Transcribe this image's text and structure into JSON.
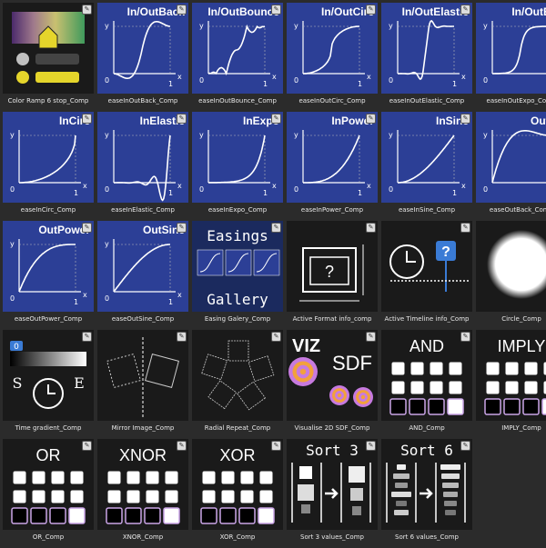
{
  "tiles": [
    {
      "caption": "Color Ramp 6 stop_Comp",
      "kind": "ramp"
    },
    {
      "caption": "easeInOutBack_Comp",
      "kind": "ease",
      "title": "In/OutBack",
      "curve": "inoutback"
    },
    {
      "caption": "easeInOutBounce_Comp",
      "kind": "ease",
      "title": "In/OutBounce",
      "curve": "inoutbounce"
    },
    {
      "caption": "easeInOutCirc_Comp",
      "kind": "ease",
      "title": "In/OutCirc",
      "curve": "inoutcirc"
    },
    {
      "caption": "easeInOutElastic_Comp",
      "kind": "ease",
      "title": "In/OutElastic",
      "curve": "inoutelastic"
    },
    {
      "caption": "easeInOutExpo_Comp",
      "kind": "ease",
      "title": "In/OutExp",
      "curve": "inoutexpo"
    },
    {
      "caption": "easeInCirc_Comp",
      "kind": "ease",
      "title": "InCirc",
      "curve": "incirc"
    },
    {
      "caption": "easeInElastic_Comp",
      "kind": "ease",
      "title": "InElastic",
      "curve": "inelastic"
    },
    {
      "caption": "easeInExpo_Comp",
      "kind": "ease",
      "title": "InExpo",
      "curve": "inexpo"
    },
    {
      "caption": "easeInPower_Comp",
      "kind": "ease",
      "title": "InPower",
      "curve": "inpower"
    },
    {
      "caption": "easeInSine_Comp",
      "kind": "ease",
      "title": "InSine",
      "curve": "insine"
    },
    {
      "caption": "easeOutBack_Comp",
      "kind": "ease",
      "title": "OutBa",
      "curve": "outback"
    },
    {
      "caption": "easeOutPower_Comp",
      "kind": "ease",
      "title": "OutPower",
      "curve": "outpower"
    },
    {
      "caption": "easeOutSine_Comp",
      "kind": "ease",
      "title": "OutSine",
      "curve": "outsine"
    },
    {
      "caption": "Easing Galery_Comp",
      "kind": "gallery",
      "t1": "Easings",
      "t2": "Gallery"
    },
    {
      "caption": "Active Format info_comp",
      "kind": "format",
      "q": "?"
    },
    {
      "caption": "Active Timeline info_Comp",
      "kind": "timeline",
      "q": "?"
    },
    {
      "caption": "Circle_Comp",
      "kind": "circle"
    },
    {
      "caption": "Time gradient_Comp",
      "kind": "timegrad",
      "zero": "0",
      "s": "S",
      "e": "E"
    },
    {
      "caption": "Mirror Image_Comp",
      "kind": "mirror"
    },
    {
      "caption": "Radial Repeat_Comp",
      "kind": "radial"
    },
    {
      "caption": "Visualise 2D SDF_Comp",
      "kind": "sdf",
      "t1": "VIZ",
      "t2": "SDF"
    },
    {
      "caption": "AND_Comp",
      "kind": "logic",
      "title": "AND"
    },
    {
      "caption": "IMPLY_Comp",
      "kind": "logic",
      "title": "IMPLY"
    },
    {
      "caption": "OR_Comp",
      "kind": "logic",
      "title": "OR"
    },
    {
      "caption": "XNOR_Comp",
      "kind": "logic",
      "title": "XNOR"
    },
    {
      "caption": "XOR_Comp",
      "kind": "logic",
      "title": "XOR"
    },
    {
      "caption": "Sort 3 values_Comp",
      "kind": "sort",
      "title": "Sort 3"
    },
    {
      "caption": "Sort 6 values_Comp",
      "kind": "sort6",
      "title": "Sort 6"
    }
  ],
  "axis": {
    "y": "y",
    "x": "x",
    "zero": "0",
    "one": "1"
  }
}
